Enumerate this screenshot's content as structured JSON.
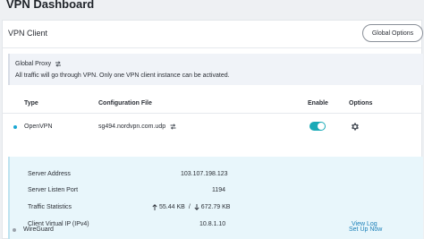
{
  "page": {
    "title": "VPN Dashboard"
  },
  "vpn_client": {
    "title": "VPN Client",
    "global_options_label": "Global Options"
  },
  "global_proxy": {
    "title": "Global Proxy",
    "description": "All traffic will go through VPN. Only one VPN client instance can be activated."
  },
  "table": {
    "headers": {
      "type": "Type",
      "config": "Configuration File",
      "enable": "Enable",
      "options": "Options"
    },
    "rows": [
      {
        "type": "OpenVPN",
        "config": "sg494.nordvpn.com.udp",
        "enabled": true,
        "status_color": "#19a7d3"
      },
      {
        "type": "WireGuard",
        "action": "Set Up Now"
      }
    ]
  },
  "details": {
    "server_address_label": "Server Address",
    "server_address": "103.107.198.123",
    "listen_port_label": "Server Listen Port",
    "listen_port": "1194",
    "traffic_label": "Traffic Statistics",
    "traffic_up": "55.44 KB",
    "traffic_sep": "/",
    "traffic_down": "672.79 KB",
    "virtual_ip_label": "Client Virtual IP (IPv4)",
    "virtual_ip": "10.8.1.10",
    "view_log": "View Log"
  },
  "colors": {
    "accent": "#19aab7",
    "link": "#1a7fb8",
    "detail_bg": "#e8f6fb"
  }
}
